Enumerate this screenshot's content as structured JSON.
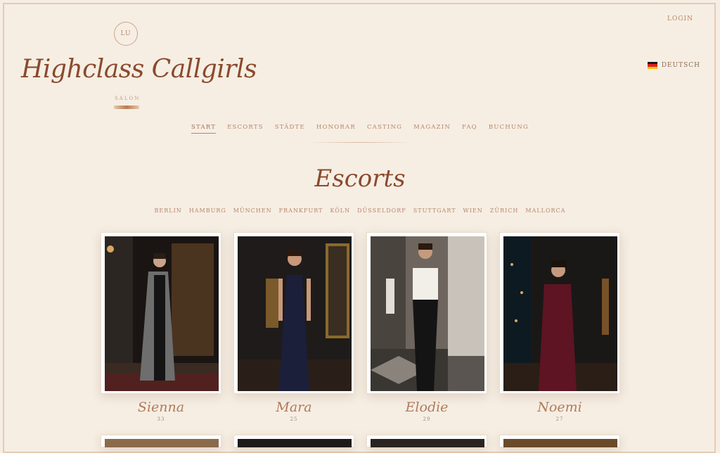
{
  "header": {
    "login_label": "LOGIN",
    "language_label": "DEUTSCH",
    "logo_badge": "LU",
    "brand_title": "Highclass Callgirls",
    "brand_subtitle": "SALON"
  },
  "nav": {
    "items": [
      {
        "label": "START",
        "active": true
      },
      {
        "label": "ESCORTS"
      },
      {
        "label": "STÄDTE"
      },
      {
        "label": "HONORAR"
      },
      {
        "label": "CASTING"
      },
      {
        "label": "MAGAZIN"
      },
      {
        "label": "FAQ"
      },
      {
        "label": "BUCHUNG"
      }
    ]
  },
  "page": {
    "title": "Escorts",
    "cities": [
      "BERLIN",
      "HAMBURG",
      "MÜNCHEN",
      "FRANKFURT",
      "KÖLN",
      "DÜSSELDORF",
      "STUTTGART",
      "WIEN",
      "ZÜRICH",
      "MALLORCA"
    ]
  },
  "profiles": [
    {
      "name": "Sienna",
      "age": "33"
    },
    {
      "name": "Mara",
      "age": "25"
    },
    {
      "name": "Elodie",
      "age": "29"
    },
    {
      "name": "Noemi",
      "age": "27"
    }
  ],
  "colors": {
    "background": "#f6eee3",
    "brand": "#8a4a2e",
    "accent": "#b5866a"
  }
}
